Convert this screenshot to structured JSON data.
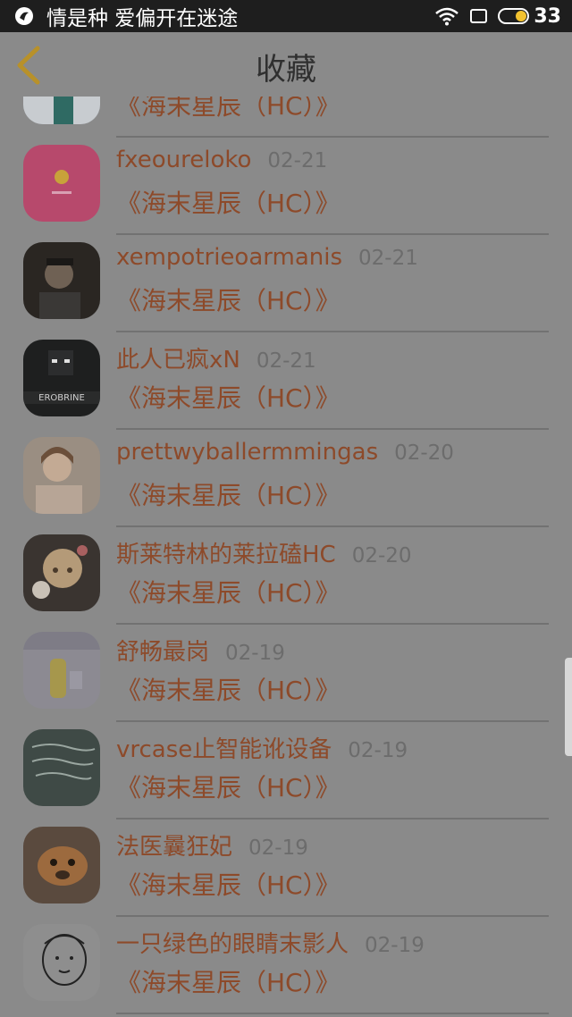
{
  "status_bar": {
    "carrier": "情是种 爱偏开在迷途",
    "battery": "33"
  },
  "header": {
    "title": "收藏"
  },
  "items": [
    {
      "name": "",
      "date": "",
      "subtitle": "《海末星辰（HC）》",
      "avatar": "avatar-minecraft-snow"
    },
    {
      "name": "fxeoureloko",
      "date": "02-21",
      "subtitle": "《海末星辰（HC）》",
      "avatar": "avatar-pink-smiley"
    },
    {
      "name": "xempotrieoarmanis",
      "date": "02-21",
      "subtitle": "《海末星辰（HC）》",
      "avatar": "avatar-person-photo"
    },
    {
      "name": "此人已疯xN",
      "date": "02-21",
      "subtitle": "《海末星辰（HC）》",
      "avatar": "avatar-herobrine"
    },
    {
      "name": "prettwyballermmingas",
      "date": "02-20",
      "subtitle": "《海末星辰（HC）》",
      "avatar": "avatar-girl-photo"
    },
    {
      "name": "斯莱特林的莱拉磕HC",
      "date": "02-20",
      "subtitle": "《海末星辰（HC）》",
      "avatar": "avatar-anime-girl"
    },
    {
      "name": "舒畅最岗",
      "date": "02-19",
      "subtitle": "《海末星辰（HC）》",
      "avatar": "avatar-cartoon-wall"
    },
    {
      "name": "vrcase止智能讹设备",
      "date": "02-19",
      "subtitle": "《海末星辰（HC）》",
      "avatar": "avatar-handwriting"
    },
    {
      "name": "法医曩狂妃",
      "date": "02-19",
      "subtitle": "《海末星辰（HC）》",
      "avatar": "avatar-dog"
    },
    {
      "name": "一只绿色的眼睛末影人",
      "date": "02-19",
      "subtitle": "《海末星辰（HC）》",
      "avatar": "avatar-doodle-face"
    }
  ],
  "colors": {
    "background": "#8a8a8a",
    "accent_text": "#8d4a2a",
    "date_text": "#6c6c6c",
    "back_arrow": "#b8912a"
  }
}
